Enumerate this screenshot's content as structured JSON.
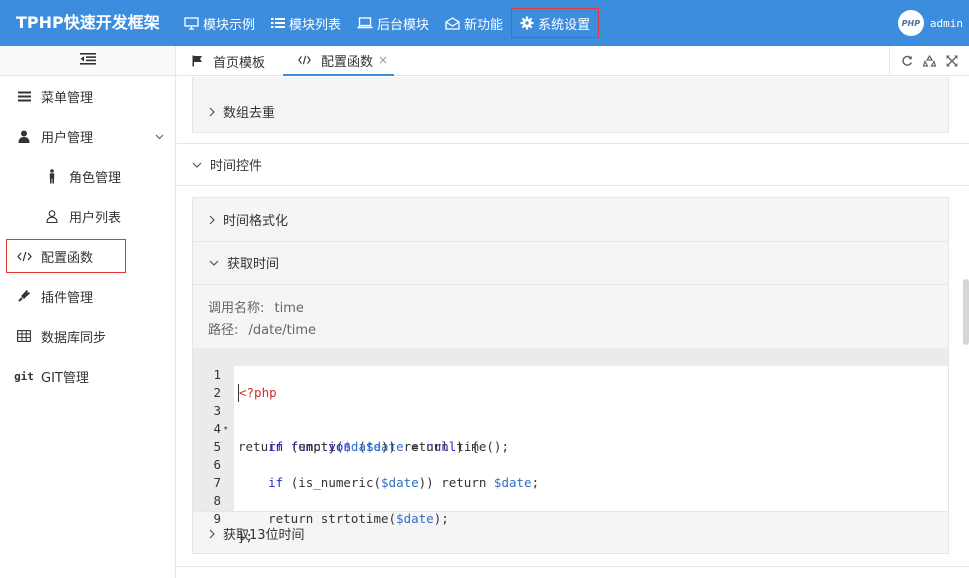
{
  "header": {
    "brand": "TPHP快速开发框架",
    "nav": [
      {
        "icon": "monitor-icon",
        "label": "模块示例"
      },
      {
        "icon": "list-icon",
        "label": "模块列表"
      },
      {
        "icon": "laptop-icon",
        "label": "后台模块"
      },
      {
        "icon": "envelope-open-icon",
        "label": "新功能"
      },
      {
        "icon": "gear-icon",
        "label": "系统设置"
      }
    ],
    "active_nav": "系统设置",
    "user": {
      "avatar_text": "PHP",
      "name": "admin"
    }
  },
  "sidebar": {
    "items": [
      {
        "icon": "menu-bars-icon",
        "label": "菜单管理"
      },
      {
        "icon": "user-icon",
        "label": "用户管理",
        "expanded": true
      },
      {
        "icon": "person-icon",
        "label": "角色管理"
      },
      {
        "icon": "user-outline-icon",
        "label": "用户列表"
      },
      {
        "icon": "code-icon",
        "label": "配置函数",
        "active": true
      },
      {
        "icon": "plug-icon",
        "label": "插件管理"
      },
      {
        "icon": "table-icon",
        "label": "数据库同步"
      },
      {
        "icon": "git-icon",
        "label": "GIT管理"
      }
    ]
  },
  "tabs": {
    "items": [
      {
        "icon": "flag-icon",
        "label": "首页模板"
      },
      {
        "icon": "code-icon",
        "label": "配置函数",
        "active": true
      }
    ],
    "close_glyph": "×"
  },
  "content": {
    "prev_group_last": "数组去重",
    "section": "时间控件",
    "items": [
      {
        "label": "时间格式化",
        "expanded": false
      },
      {
        "label": "获取时间",
        "expanded": true
      },
      {
        "label": "获取13位时间",
        "expanded": false
      }
    ],
    "detail": {
      "call_label": "调用名称:",
      "call_value": "time",
      "path_label": "路径:",
      "path_value": "/date/time"
    },
    "code_lines": [
      "<?php",
      "",
      "return function ($date = null) {",
      "    if (empty($date)) return time();",
      "",
      "    if (is_numeric($date)) return $date;",
      "",
      "    return strtotime($date);",
      "};"
    ],
    "line_numbers": [
      "1",
      "2",
      "3",
      "4",
      "5",
      "6",
      "7",
      "8",
      "9"
    ]
  },
  "colors": {
    "header_bg": "#3c8dde",
    "highlight_border": "#e63a3a",
    "keyword": "#2a2ad4",
    "variable": "#2f6fc7",
    "php_tag": "#d52a2a"
  }
}
